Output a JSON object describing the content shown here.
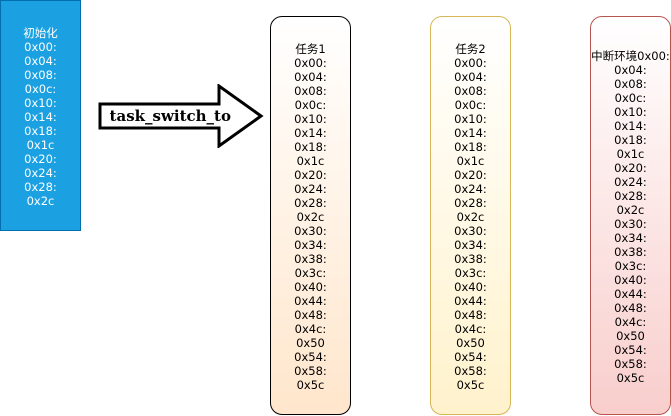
{
  "init_box": {
    "title": "初始化",
    "lines": [
      "0x00:",
      "0x04:",
      "0x08:",
      "0x0c:",
      "0x10:",
      "0x14:",
      "0x18:",
      "0x1c",
      "0x20:",
      "0x24:",
      "0x28:",
      "0x2c"
    ]
  },
  "arrow": {
    "label": "task_switch_to"
  },
  "task1_box": {
    "title": "任务1",
    "lines": [
      "0x00:",
      "0x04:",
      "0x08:",
      "0x0c:",
      "0x10:",
      "0x14:",
      "0x18:",
      "0x1c",
      "0x20:",
      "0x24:",
      "0x28:",
      "0x2c",
      "0x30:",
      "0x34:",
      "0x38:",
      "0x3c:",
      "0x40:",
      "0x44:",
      "0x48:",
      "0x4c:",
      "0x50",
      "0x54:",
      "0x58:",
      "0x5c"
    ]
  },
  "task2_box": {
    "title": "任务2",
    "lines": [
      "0x00:",
      "0x04:",
      "0x08:",
      "0x0c:",
      "0x10:",
      "0x14:",
      "0x18:",
      "0x1c",
      "0x20:",
      "0x24:",
      "0x28:",
      "0x2c",
      "0x30:",
      "0x34:",
      "0x38:",
      "0x3c:",
      "0x40:",
      "0x44:",
      "0x48:",
      "0x4c:",
      "0x50",
      "0x54:",
      "0x58:",
      "0x5c"
    ]
  },
  "irq_box": {
    "title": "中断环境0x00:",
    "lines": [
      "0x04:",
      "0x08:",
      "0x0c:",
      "0x10:",
      "0x14:",
      "0x18:",
      "0x1c",
      "0x20:",
      "0x24:",
      "0x28:",
      "0x2c",
      "0x30:",
      "0x34:",
      "0x38:",
      "0x3c:",
      "0x40:",
      "0x44:",
      "0x48:",
      "0x4c:",
      "0x50",
      "0x54:",
      "0x58:",
      "0x5c"
    ]
  },
  "colors": {
    "init_fill": "#1ba1e2",
    "init_stroke": "#006eaf",
    "task1_stroke": "#000000",
    "task1_fill_bottom": "#ffe6cc",
    "task2_stroke": "#d6b656",
    "task2_fill_bottom": "#fff2cc",
    "irq_stroke": "#b85450",
    "irq_fill_bottom": "#f8cecc"
  }
}
